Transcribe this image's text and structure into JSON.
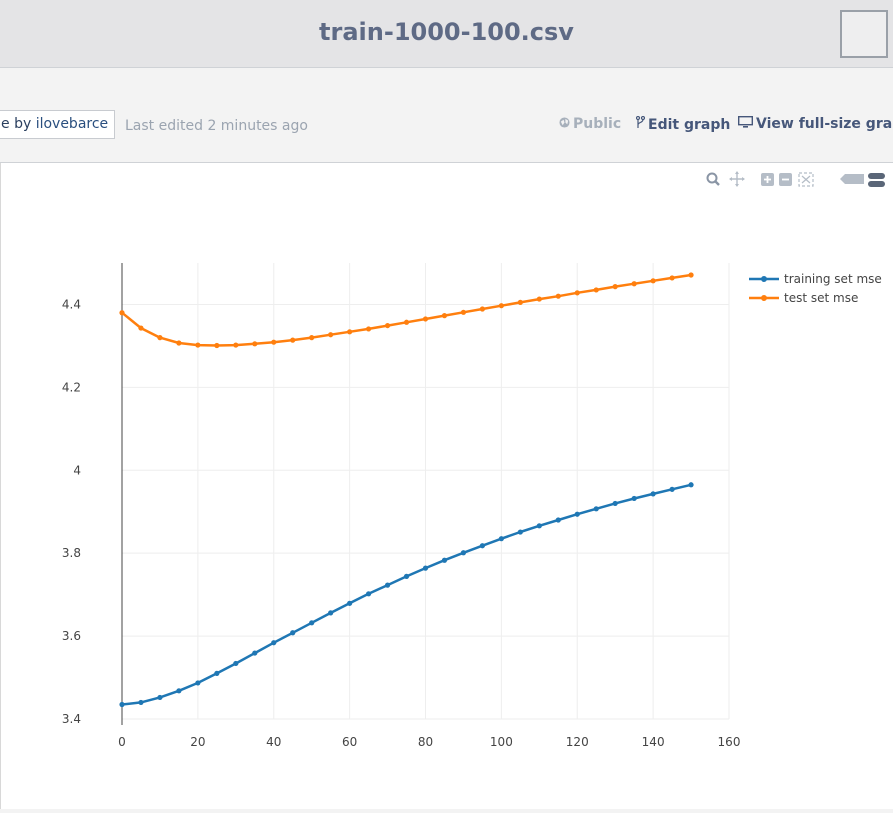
{
  "header": {
    "title": "train-1000-100.csv"
  },
  "toolbar": {
    "author_prefix": "e by ",
    "author_name": "ilovebarce",
    "last_edited": "Last edited 2 minutes ago",
    "public_label": "Public",
    "edit_graph_label": "Edit graph",
    "view_full_label": "View full-size graph"
  },
  "modebar": {
    "icons": [
      "zoom-icon",
      "pan-icon",
      "zoom-in-icon",
      "zoom-out-icon",
      "autoscale-icon",
      "compare-hover-icon",
      "closest-hover-icon"
    ]
  },
  "colors": {
    "training": "#1f77b4",
    "test": "#ff7f0e"
  },
  "chart_data": {
    "type": "line",
    "title": "",
    "xlabel": "",
    "ylabel": "",
    "xlim": [
      0,
      160
    ],
    "ylim": [
      3.4,
      4.5
    ],
    "x_ticks": [
      0,
      20,
      40,
      60,
      80,
      100,
      120,
      140,
      160
    ],
    "y_ticks": [
      3.4,
      3.6,
      3.8,
      4,
      4.2,
      4.4
    ],
    "grid": true,
    "legend": "top-right",
    "x": [
      0,
      5,
      10,
      15,
      20,
      25,
      30,
      35,
      40,
      45,
      50,
      55,
      60,
      65,
      70,
      75,
      80,
      85,
      90,
      95,
      100,
      105,
      110,
      115,
      120,
      125,
      130,
      135,
      140,
      145,
      150
    ],
    "series": [
      {
        "name": "training set mse",
        "values": [
          3.435,
          3.44,
          3.452,
          3.468,
          3.487,
          3.51,
          3.534,
          3.559,
          3.584,
          3.608,
          3.632,
          3.656,
          3.679,
          3.702,
          3.723,
          3.744,
          3.764,
          3.783,
          3.801,
          3.818,
          3.835,
          3.851,
          3.866,
          3.88,
          3.894,
          3.907,
          3.92,
          3.932,
          3.943,
          3.954,
          3.965
        ]
      },
      {
        "name": "test set mse",
        "values": [
          4.38,
          4.343,
          4.32,
          4.307,
          4.302,
          4.301,
          4.302,
          4.305,
          4.309,
          4.314,
          4.32,
          4.327,
          4.334,
          4.341,
          4.349,
          4.357,
          4.365,
          4.373,
          4.381,
          4.389,
          4.397,
          4.405,
          4.413,
          4.42,
          4.428,
          4.435,
          4.443,
          4.45,
          4.457,
          4.464,
          4.471
        ]
      }
    ]
  }
}
